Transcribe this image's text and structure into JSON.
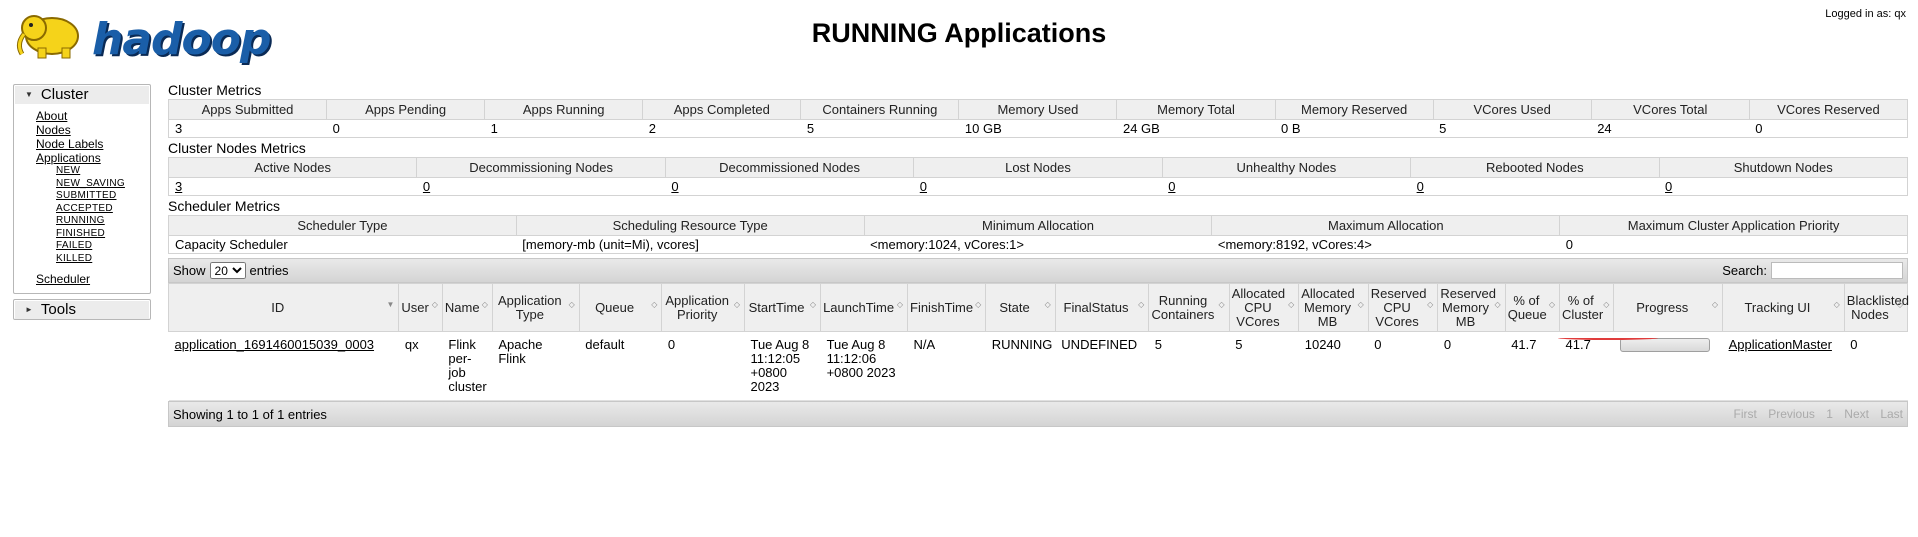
{
  "header": {
    "logo_text": "hadoop",
    "title": "RUNNING Applications",
    "logged_in": "Logged in as: qx"
  },
  "nav": {
    "cluster_label": "Cluster",
    "cluster_links": [
      "About",
      "Nodes",
      "Node Labels",
      "Applications"
    ],
    "app_states": [
      "NEW",
      "NEW_SAVING",
      "SUBMITTED",
      "ACCEPTED",
      "RUNNING",
      "FINISHED",
      "FAILED",
      "KILLED"
    ],
    "scheduler": "Scheduler",
    "tools_label": "Tools"
  },
  "cluster_metrics": {
    "title": "Cluster Metrics",
    "headers": [
      "Apps Submitted",
      "Apps Pending",
      "Apps Running",
      "Apps Completed",
      "Containers Running",
      "Memory Used",
      "Memory Total",
      "Memory Reserved",
      "VCores Used",
      "VCores Total",
      "VCores Reserved"
    ],
    "values": [
      "3",
      "0",
      "1",
      "2",
      "5",
      "10 GB",
      "24 GB",
      "0 B",
      "5",
      "24",
      "0"
    ]
  },
  "node_metrics": {
    "title": "Cluster Nodes Metrics",
    "headers": [
      "Active Nodes",
      "Decommissioning Nodes",
      "Decommissioned Nodes",
      "Lost Nodes",
      "Unhealthy Nodes",
      "Rebooted Nodes",
      "Shutdown Nodes"
    ],
    "values": [
      "3",
      "0",
      "0",
      "0",
      "0",
      "0",
      "0"
    ]
  },
  "scheduler_metrics": {
    "title": "Scheduler Metrics",
    "headers": [
      "Scheduler Type",
      "Scheduling Resource Type",
      "Minimum Allocation",
      "Maximum Allocation",
      "Maximum Cluster Application Priority"
    ],
    "values": [
      "Capacity Scheduler",
      "[memory-mb (unit=Mi), vcores]",
      "<memory:1024, vCores:1>",
      "<memory:8192, vCores:4>",
      "0"
    ]
  },
  "apps_table": {
    "show_label": "Show",
    "entries_value": "20",
    "entries_label": "entries",
    "search_label": "Search:",
    "search_value": "",
    "headers": [
      "ID",
      "User",
      "Name",
      "Application Type",
      "Queue",
      "Application Priority",
      "StartTime",
      "LaunchTime",
      "FinishTime",
      "State",
      "FinalStatus",
      "Running Containers",
      "Allocated CPU VCores",
      "Allocated Memory MB",
      "Reserved CPU VCores",
      "Reserved Memory MB",
      "% of Queue",
      "% of Cluster",
      "Progress",
      "Tracking UI",
      "Blacklisted Nodes"
    ],
    "row": {
      "id": "application_1691460015039_0003",
      "user": "qx",
      "name": "Flink per-job cluster",
      "type": "Apache Flink",
      "queue": "default",
      "priority": "0",
      "start": "Tue Aug 8 11:12:05 +0800 2023",
      "launch": "Tue Aug 8 11:12:06 +0800 2023",
      "finish": "N/A",
      "state": "RUNNING",
      "final_status": "UNDEFINED",
      "running_containers": "5",
      "alloc_vcores": "5",
      "alloc_mem": "10240",
      "res_vcores": "0",
      "res_mem": "0",
      "pct_queue": "41.7",
      "pct_cluster": "41.7",
      "progress": 0,
      "tracking": "ApplicationMaster",
      "blacklisted": "0"
    },
    "info": "Showing 1 to 1 of 1 entries",
    "pager": [
      "First",
      "Previous",
      "1",
      "Next",
      "Last"
    ]
  }
}
